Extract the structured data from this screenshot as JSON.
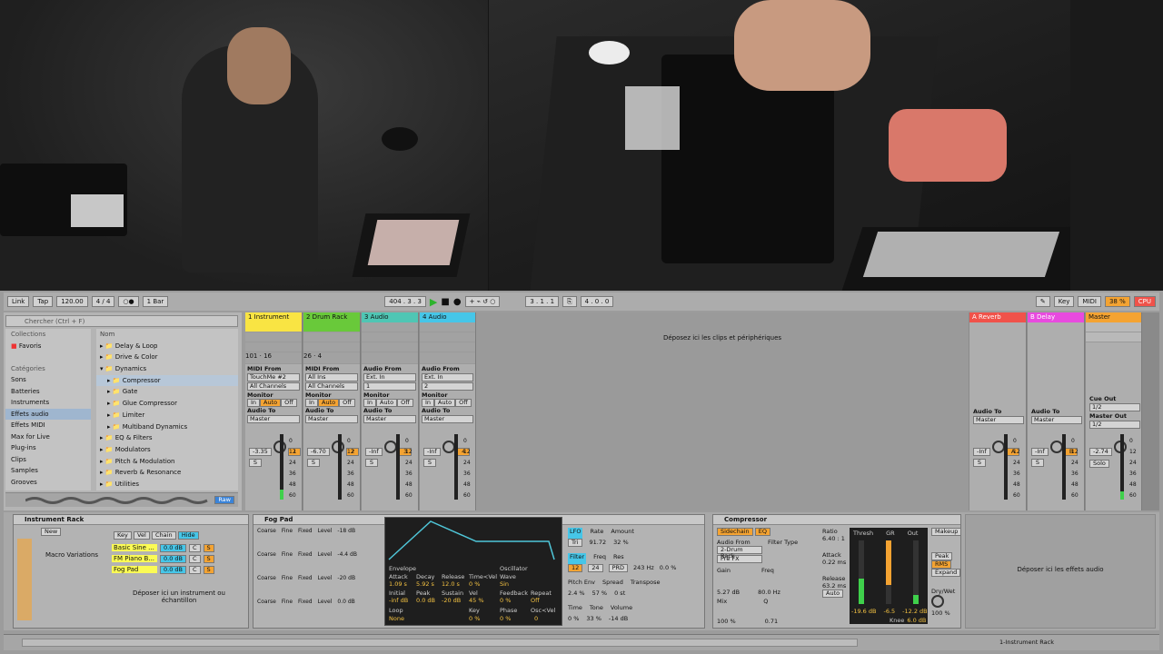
{
  "transport": {
    "link": "Link",
    "tap": "Tap",
    "tempo": "120.00",
    "signature": "4 / 4",
    "quantize": "1 Bar",
    "position": "404 .  3 .  3",
    "loop_start": "3 .  1 .  1",
    "loop_length": "4 .  0 .  0",
    "key_btn": "Key",
    "midi_btn": "MIDI",
    "cpu_pct": "38 %",
    "cpu_label": "CPU"
  },
  "browser": {
    "search_placeholder": "Chercher (Ctrl + F)",
    "collections_header": "Collections",
    "favorites": "Favoris",
    "categories_header": "Catégories",
    "categories": [
      "Sons",
      "Batteries",
      "Instruments",
      "Effets audio",
      "Effets MIDI",
      "Max for Live",
      "Plug-ins",
      "Clips",
      "Samples",
      "Grooves"
    ],
    "name_header": "Nom",
    "tree": [
      "Delay & Loop",
      "Drive & Color",
      "Dynamics",
      "Compressor",
      "Gate",
      "Glue Compressor",
      "Limiter",
      "Multiband Dynamics",
      "EQ & Filters",
      "Modulators",
      "Pitch & Modulation",
      "Reverb & Resonance",
      "Utilities"
    ],
    "raw": "Raw"
  },
  "tracks": [
    {
      "name": "1 Instrument",
      "color": "#f9e443",
      "midi_from": "TouchMe #2",
      "channel": "All Channels",
      "vol": "-3.35",
      "num": "1",
      "sends": [
        "101",
        "16"
      ],
      "audio_to": "Master"
    },
    {
      "name": "2 Drum Rack",
      "color": "#69c93a",
      "midi_from": "All Ins",
      "channel": "All Channels",
      "vol": "-6.70",
      "num": "2",
      "sends": [
        "26",
        "4"
      ],
      "audio_to": "Master"
    },
    {
      "name": "3 Audio",
      "color": "#4fc6b4",
      "midi_from": "Ext. In",
      "channel": "1",
      "vol": "-Inf",
      "num": "3",
      "audio_to": "Master"
    },
    {
      "name": "4 Audio",
      "color": "#46c6e8",
      "midi_from": "Ext. In",
      "channel": "2",
      "vol": "-Inf",
      "num": "4",
      "audio_to": "Master"
    }
  ],
  "labels": {
    "midi_from": "MIDI From",
    "audio_from": "Audio From",
    "monitor": "Monitor",
    "in": "In",
    "auto": "Auto",
    "off": "Off",
    "audio_to": "Audio To",
    "drop_clips": "Déposez ici les clips et périphériques",
    "cue_out": "Cue Out",
    "cue_val": "1/2",
    "master_out": "Master Out",
    "master_val": "1/2",
    "scale": [
      "0",
      "12",
      "24",
      "36",
      "48",
      "60"
    ],
    "s": "S"
  },
  "returns": [
    {
      "name": "A Reverb",
      "color": "#f0524a",
      "vol": "-Inf",
      "letter": "A",
      "audio_to": "Master"
    },
    {
      "name": "B Delay",
      "color": "#e84adf",
      "vol": "-Inf",
      "letter": "B",
      "audio_to": "Master"
    },
    {
      "name": "Master",
      "color": "#f4a332",
      "vol": "-2.74",
      "solo": "Solo"
    }
  ],
  "instrument_rack": {
    "title": "Instrument Rack",
    "new": "New",
    "key": "Key",
    "vel": "Vel",
    "chain": "Chain",
    "hide": "Hide",
    "macro": "Macro Variations",
    "chains": [
      {
        "name": "Basic Sine ...",
        "db": "0.0 dB",
        "pan": "C"
      },
      {
        "name": "FM Piano B...",
        "db": "0.0 dB",
        "pan": "C"
      },
      {
        "name": "Fog Pad",
        "db": "0.0 dB",
        "pan": "C"
      }
    ],
    "drop": "Déposer ici un instrument ou échantillon"
  },
  "fog_pad": {
    "title": "Fog Pad",
    "rows": [
      {
        "coarse": "Coarse",
        "fine": "Fine",
        "fixed": "Fixed",
        "level": "Level",
        "lv": "-18 dB"
      },
      {
        "coarse": "Coarse",
        "fine": "Fine",
        "fixed": "Fixed",
        "level": "Level",
        "lv": "-4.4 dB"
      },
      {
        "coarse": "Coarse",
        "fine": "Fine",
        "fixed": "Fixed",
        "level": "Level",
        "lv": "-20 dB"
      },
      {
        "coarse": "Coarse",
        "fine": "Fine",
        "fixed": "Fixed",
        "level": "Level",
        "lv": "0.0 dB"
      }
    ],
    "env": {
      "envelope": "Envelope",
      "oscillator": "Oscillator",
      "h1": [
        "Attack",
        "Decay",
        "Release",
        "Time<Vel"
      ],
      "v1": [
        "1.09 s",
        "5.92 s",
        "12.0 s",
        "0 %"
      ],
      "h2": [
        "Initial",
        "Peak",
        "Sustain",
        "Vel"
      ],
      "v2": [
        "-inf dB",
        "0.0 dB",
        "-20 dB",
        "45 %"
      ],
      "loop": "Loop",
      "loop_val": "None",
      "key": "Key",
      "key_val": "0 %",
      "wave": "Wave",
      "wave_val": "Sin",
      "feedback": "Feedback",
      "fb_val": "0 %",
      "repeat": "Repeat",
      "rep_val": "Off",
      "phase": "Phase",
      "phase_val": "0 %",
      "osc_vel": "Osc<Vel",
      "ov_val": "0"
    },
    "lfo": {
      "lfo": "LFO",
      "tri": "Tri",
      "rate": "Rate",
      "rate_val": "91.72",
      "amount": "Amount",
      "amount_val": "32 %",
      "filter": "Filter",
      "n12": "12",
      "n24": "24",
      "prd": "PRD",
      "freq": "Freq",
      "freq_val": "243 Hz",
      "res": "Res",
      "res_val": "0.0 %",
      "pitch_env": "Pitch Env",
      "pe_val": "2.4 %",
      "spread": "Spread",
      "spread_val": "57 %",
      "transpose": "Transpose",
      "tr_val": "0 st",
      "time": "Time",
      "time_val": "0 %",
      "tone": "Tone",
      "tone_val": "33 %",
      "volume": "Volume",
      "vol_val": "-14 dB"
    }
  },
  "compressor": {
    "title": "Compressor",
    "sidechain": "Sidechain",
    "eq": "EQ",
    "audio_from": "Audio From",
    "af_val": "2-Drum Rack",
    "pre": "Pre FX",
    "filter_type": "Filter Type",
    "gain": "Gain",
    "gain_val": "5.27 dB",
    "freq": "Freq",
    "freq_val": "80.0 Hz",
    "mix": "Mix",
    "mix_val": "100 %",
    "q": "Q",
    "q_val": "0.71",
    "ratio": "Ratio",
    "ratio_val": "6.40 : 1",
    "attack": "Attack",
    "attack_val": "0.22 ms",
    "release": "Release",
    "release_val": "63.2 ms",
    "auto": "Auto",
    "thresh": "Thresh",
    "gr": "GR",
    "out": "Out",
    "thresh_val": "-19.6 dB",
    "gr_val": "-6.5",
    "out_val": "-12.2 dB",
    "knee": "Knee",
    "knee_val": "6.0 dB",
    "makeup": "Makeup",
    "peak": "Peak",
    "rms": "RMS",
    "expand": "Expand",
    "drywet": "Dry/Wet",
    "dw_val": "100 %"
  },
  "drop_effects": "Déposer ici les effets audio",
  "status": {
    "right": "1-Instrument Rack"
  }
}
